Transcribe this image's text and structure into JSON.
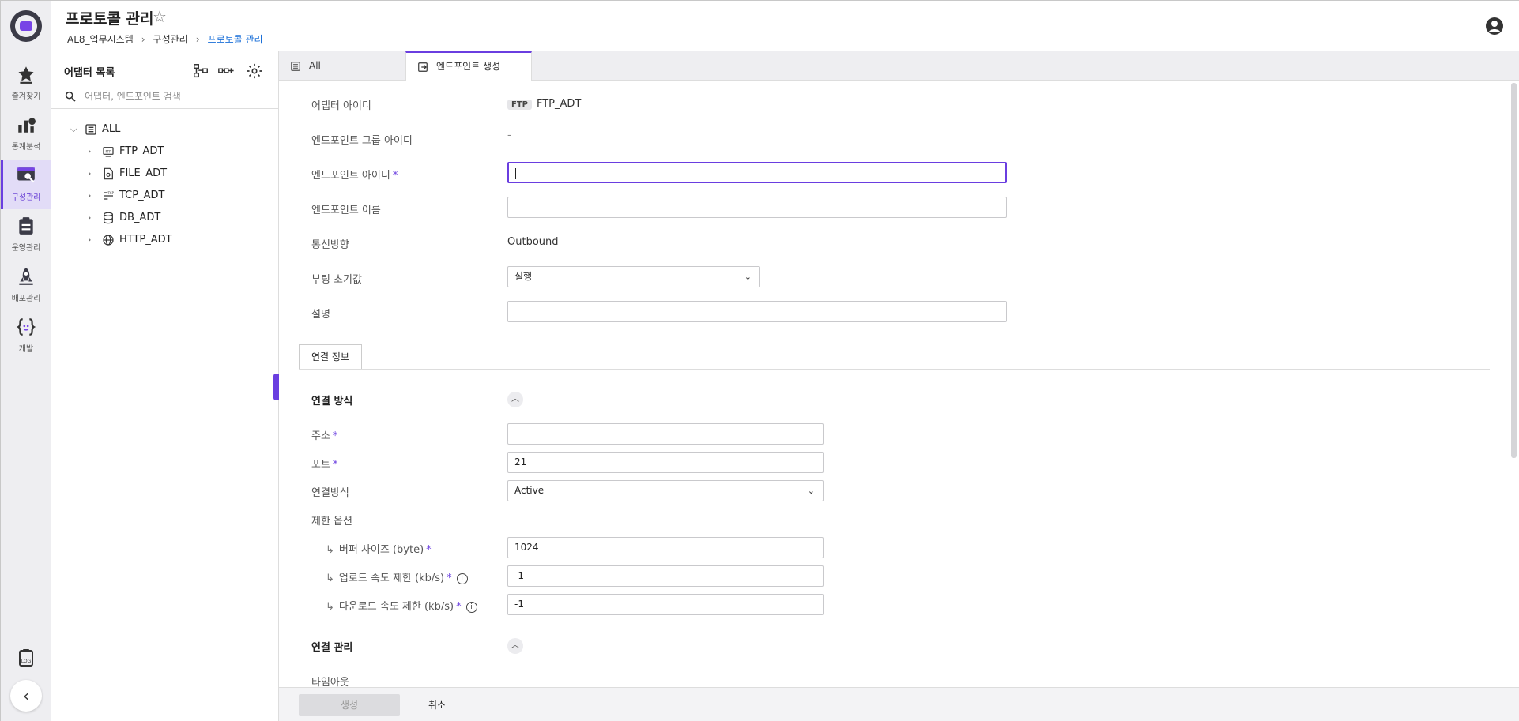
{
  "header": {
    "title": "프로토콜 관리",
    "breadcrumb": [
      "AL8_업무시스템",
      "구성관리",
      "프로토콜 관리"
    ]
  },
  "nav": {
    "items": [
      {
        "label": "즐겨찾기",
        "icon": "star-icon"
      },
      {
        "label": "통계분석",
        "icon": "chart-icon"
      },
      {
        "label": "구성관리",
        "icon": "config-icon"
      },
      {
        "label": "운영관리",
        "icon": "clipboard-icon"
      },
      {
        "label": "배포관리",
        "icon": "rocket-icon"
      },
      {
        "label": "개발",
        "icon": "code-braces-icon"
      }
    ],
    "active_index": 2
  },
  "panel": {
    "title": "어댑터 목록",
    "search_placeholder": "어댑터, 엔드포인트 검색",
    "tree": {
      "root": "ALL",
      "children": [
        "FTP_ADT",
        "FILE_ADT",
        "TCP_ADT",
        "DB_ADT",
        "HTTP_ADT"
      ]
    }
  },
  "tabs": [
    {
      "label": "All"
    },
    {
      "label": "엔드포인트 생성"
    }
  ],
  "form": {
    "adapter_id_label": "어댑터 아이디",
    "adapter_badge": "FTP",
    "adapter_id": "FTP_ADT",
    "endpoint_group_label": "엔드포인트 그룹 아이디",
    "endpoint_group_value": "-",
    "endpoint_id_label": "엔드포인트 아이디",
    "endpoint_name_label": "엔드포인트 이름",
    "direction_label": "통신방향",
    "direction_value": "Outbound",
    "boot_label": "부팅 초기값",
    "boot_value": "실행",
    "desc_label": "설명",
    "required_mark": "*"
  },
  "connection": {
    "tab_label": "연결 정보",
    "section1_title": "연결 방식",
    "address_label": "주소",
    "port_label": "포트",
    "port_value": "21",
    "mode_label": "연결방식",
    "mode_value": "Active",
    "limit_label": "제한 옵션",
    "buffer_label": "버퍼 사이즈 (byte)",
    "buffer_value": "1024",
    "upload_label": "업로드 속도 제한 (kb/s)",
    "upload_value": "-1",
    "download_label": "다운로드 속도 제한 (kb/s)",
    "download_value": "-1",
    "section2_title": "연결 관리",
    "timeout_label": "타임아웃"
  },
  "footer": {
    "create_label": "생성",
    "cancel_label": "취소"
  },
  "colors": {
    "accent": "#6a3ee0",
    "link": "#1a6fd8"
  }
}
